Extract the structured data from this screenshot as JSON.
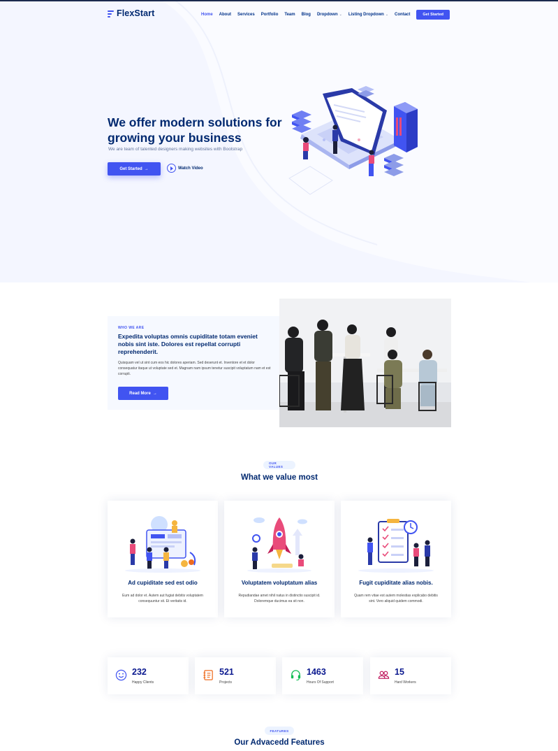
{
  "header": {
    "logo_text": "FlexStart",
    "nav": [
      {
        "label": "Home",
        "active": true,
        "dropdown": false
      },
      {
        "label": "About",
        "active": false,
        "dropdown": false
      },
      {
        "label": "Services",
        "active": false,
        "dropdown": false
      },
      {
        "label": "Portfolio",
        "active": false,
        "dropdown": false
      },
      {
        "label": "Team",
        "active": false,
        "dropdown": false
      },
      {
        "label": "Blog",
        "active": false,
        "dropdown": false
      },
      {
        "label": "Dropdown",
        "active": false,
        "dropdown": true
      },
      {
        "label": "Listing Dropdown",
        "active": false,
        "dropdown": true
      },
      {
        "label": "Contact",
        "active": false,
        "dropdown": false
      }
    ],
    "cta": "Get Started"
  },
  "hero": {
    "title": "We offer modern solutions for growing your business",
    "subtitle": "We are team of talented designers making websites with Bootstrap",
    "button": "Get Started",
    "watch": "Watch Video"
  },
  "about": {
    "label": "WHO WE ARE",
    "title": "Expedita voluptas omnis cupiditate totam eveniet nobis sint iste. Dolores est repellat corrupti reprehenderit.",
    "text": "Quisquam vel ut sint cum eos hic dolores aperiam. Sed deserunt et. Inventore et et dolor consequatur itaque ut voluptate sed et. Magnam nam ipsum tenetur suscipit voluptatum nam et est corrupti.",
    "button": "Read More"
  },
  "values": {
    "pill": "OUR VALUES",
    "title": "What we value most",
    "cards": [
      {
        "title": "Ad cupiditate sed est odio",
        "text": "Eum ad dolor et. Autem aut fugiat debitis voluptatem consequuntur sit. Et veritatis id."
      },
      {
        "title": "Voluptatem voluptatum alias",
        "text": "Repudiandae amet nihil natus in distinctio suscipit id. Doloremque ducimus ea sit non."
      },
      {
        "title": "Fugit cupiditate alias nobis.",
        "text": "Quam rem vitae est autem molestias explicabo debitis sint. Vero aliquid quidem commodi."
      }
    ]
  },
  "counts": [
    {
      "value": "232",
      "label": "Happy Clients",
      "icon": "emoji-smile-icon",
      "color": "#4154f1"
    },
    {
      "value": "521",
      "label": "Projects",
      "icon": "journal-richtext-icon",
      "color": "#ee6c20"
    },
    {
      "value": "1463",
      "label": "Hours Of Support",
      "icon": "headset-icon",
      "color": "#15be56"
    },
    {
      "value": "15",
      "label": "Hard Workers",
      "icon": "people-icon",
      "color": "#bb0852"
    }
  ],
  "features": {
    "pill": "FEATURES",
    "title": "Our Advacedd Features"
  },
  "colors": {
    "primary": "#4154f1",
    "heading": "#012970",
    "hero_bg": "#f4f6ff"
  }
}
